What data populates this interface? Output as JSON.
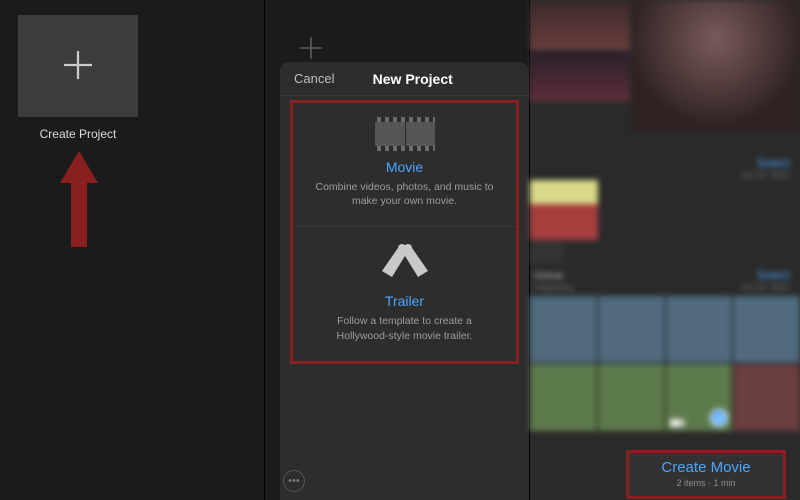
{
  "left": {
    "create_label": "Create Project"
  },
  "mid": {
    "cancel": "Cancel",
    "sheet_title": "New Project",
    "movie": {
      "title": "Movie",
      "desc": "Combine videos, photos, and music to make your own movie."
    },
    "trailer": {
      "title": "Trailer",
      "desc": "Follow a template to create a Hollywood-style movie trailer."
    }
  },
  "right": {
    "select1": "Select",
    "date1": "Jul 10, 2021",
    "section_title": "Home",
    "section_sub": "Magalang",
    "select2": "Select",
    "date2": "Jul 10, 2021",
    "create_title": "Create Movie",
    "create_sub": "2 items · 1 min"
  }
}
